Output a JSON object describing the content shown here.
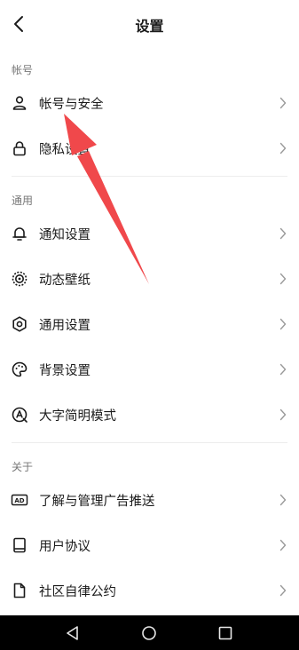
{
  "header": {
    "title": "设置",
    "back_icon": "chevron-left-icon"
  },
  "sections": {
    "account": "帐号",
    "general": "通用",
    "about": "关于"
  },
  "items": {
    "account_security": {
      "label": "帐号与安全",
      "icon": "user-icon"
    },
    "privacy": {
      "label": "隐私设置",
      "icon": "lock-icon"
    },
    "notifications": {
      "label": "通知设置",
      "icon": "bell-icon"
    },
    "live_wallpaper": {
      "label": "动态壁纸",
      "icon": "wallpaper-icon"
    },
    "general_settings": {
      "label": "通用设置",
      "icon": "gear-icon"
    },
    "background": {
      "label": "背景设置",
      "icon": "palette-icon"
    },
    "large_font": {
      "label": "大字简明模式",
      "icon": "font-icon"
    },
    "ads": {
      "label": "了解与管理广告推送",
      "icon": "ad-icon"
    },
    "user_agreement": {
      "label": "用户协议",
      "icon": "book-icon"
    },
    "community": {
      "label": "社区自律公约",
      "icon": "document-icon"
    }
  },
  "colors": {
    "annotation_arrow": "#f0484b"
  },
  "navbar": {
    "buttons": [
      "back-triangle-icon",
      "home-circle-icon",
      "recents-square-icon"
    ]
  }
}
